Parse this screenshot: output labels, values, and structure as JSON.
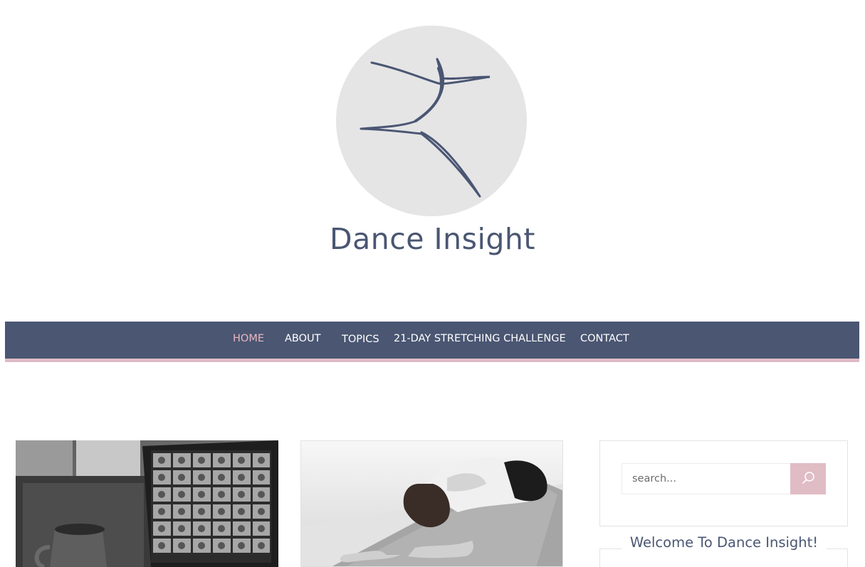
{
  "site": {
    "title": "Dance Insight",
    "logo_icon": "dancer-icon"
  },
  "nav": {
    "items": [
      {
        "label": "HOME",
        "active": true
      },
      {
        "label": "ABOUT",
        "active": false
      },
      {
        "label": "TOPICS",
        "active": false
      },
      {
        "label": "21-DAY STRETCHING CHALLENGE",
        "active": false
      },
      {
        "label": "CONTACT",
        "active": false
      }
    ]
  },
  "sidebar": {
    "search": {
      "placeholder": "search...",
      "button_icon": "search-icon"
    },
    "welcome_title": "Welcome To Dance Insight!"
  },
  "colors": {
    "primary": "#4a5672",
    "accent": "#e0bcc5",
    "active_nav": "#eab8c3",
    "logo_circle": "#e5e5e6"
  }
}
